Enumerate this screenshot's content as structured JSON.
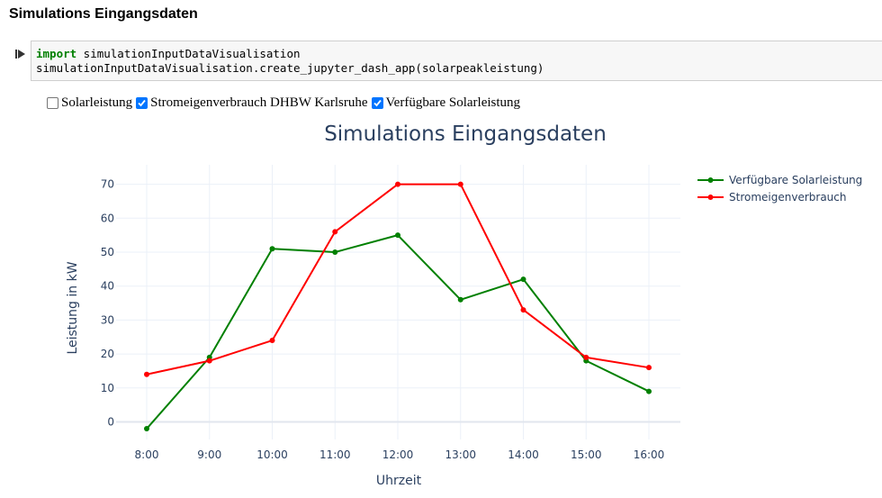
{
  "notebook": {
    "heading": "Simulations Eingangsdaten",
    "code": {
      "line1_keyword": "import",
      "line1_module": " simulationInputDataVisualisation",
      "line2": "simulationInputDataVisualisation.create_jupyter_dash_app(solarpeakleistung)"
    }
  },
  "checklist": [
    {
      "label": "Solarleistung",
      "checked": false
    },
    {
      "label": "Stromeigenverbrauch DHBW Karlsruhe",
      "checked": true
    },
    {
      "label": "Verfügbare Solarleistung",
      "checked": true
    }
  ],
  "colors": {
    "checkbox_accent": "#0075ff",
    "grid": "#ebf0f8",
    "text": "#2a3f5f"
  },
  "chart_data": {
    "type": "line",
    "title": "Simulations Eingangsdaten",
    "xlabel": "Uhrzeit",
    "ylabel": "Leistung in kW",
    "categories": [
      "8:00",
      "9:00",
      "10:00",
      "11:00",
      "12:00",
      "13:00",
      "14:00",
      "15:00",
      "16:00"
    ],
    "yticks": [
      "0",
      "10",
      "20",
      "30",
      "40",
      "50",
      "60",
      "70"
    ],
    "ylim": [
      -4,
      75
    ],
    "grid": true,
    "legend_position": "top-right",
    "series": [
      {
        "name": "Verfügbare Solarleistung",
        "color": "#008000",
        "values": [
          -2,
          19,
          51,
          50,
          55,
          36,
          42,
          18,
          9
        ]
      },
      {
        "name": "Stromeigenverbrauch",
        "color": "#ff0000",
        "values": [
          14,
          18,
          24,
          56,
          70,
          70,
          33,
          19,
          16
        ]
      }
    ]
  }
}
